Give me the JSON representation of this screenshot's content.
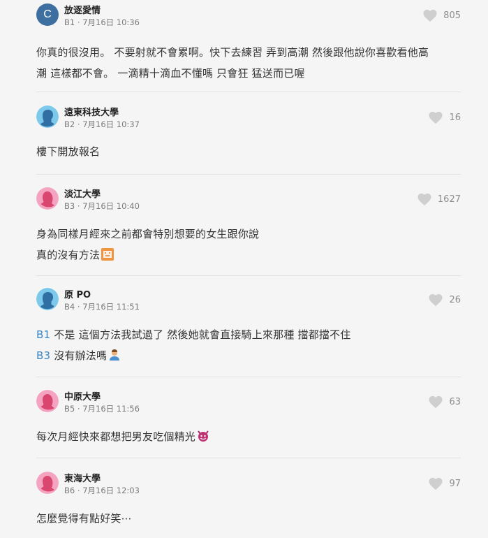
{
  "colors": {
    "accent_link": "#3b87c6",
    "background": "#f5f5f5"
  },
  "comments": [
    {
      "author": "放逐愛情",
      "avatar_type": "letter",
      "avatar_letter": "C",
      "floor": "B1",
      "date": "7月16日 10:36",
      "likes": "805",
      "lines": [
        "你真的很沒用。 不要射就不會累啊。快下去練習 弄到高潮 然後跟他說你喜歡看他高",
        "潮 這樣都不會。 一滴精十滴血不懂嗎 只會狂  猛送而已喔"
      ]
    },
    {
      "author": "遠東科技大學",
      "avatar_type": "male-icon",
      "floor": "B2",
      "date": "7月16日 10:37",
      "likes": "16",
      "lines": [
        "樓下開放報名"
      ]
    },
    {
      "author": "淡江大學",
      "avatar_type": "female-icon",
      "floor": "B3",
      "date": "7月16日 10:40",
      "likes": "1627",
      "lines": [
        "身為同樣月經來之前都會特別想要的女生跟你說",
        "真的沒有方法"
      ]
    },
    {
      "author": "原 PO",
      "avatar_type": "male-icon",
      "floor": "B4",
      "date": "7月16日 11:51",
      "likes": "26",
      "ref1": "B1",
      "ref1_text": " 不是 這個方法我試過了 然後她就會直接騎上來那種 擋都擋不住",
      "ref2": "B3",
      "ref2_text": " 沒有辦法嗎"
    },
    {
      "author": "中原大學",
      "avatar_type": "female-icon",
      "floor": "B5",
      "date": "7月16日 11:56",
      "likes": "63",
      "lines": [
        "每次月經快來都想把男友吃個精光"
      ]
    },
    {
      "author": "東海大學",
      "avatar_type": "female-icon",
      "floor": "B6",
      "date": "7月16日 12:03",
      "likes": "97",
      "lines": [
        "怎麼覺得有點好笑⋯"
      ]
    }
  ]
}
